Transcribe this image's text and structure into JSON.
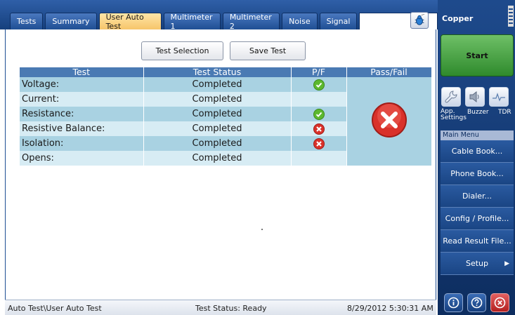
{
  "tabs": [
    {
      "label": "Tests",
      "active": false
    },
    {
      "label": "Summary",
      "active": false
    },
    {
      "label": "User Auto Test",
      "active": true
    },
    {
      "label": "Multimeter 1",
      "active": false
    },
    {
      "label": "Multimeter 2",
      "active": false
    },
    {
      "label": "Noise",
      "active": false
    },
    {
      "label": "Signal",
      "active": false
    }
  ],
  "toolbar": {
    "test_selection": "Test Selection",
    "save_test": "Save Test"
  },
  "table": {
    "headers": {
      "test": "Test",
      "status": "Test Status",
      "pf": "P/F",
      "passfail": "Pass/Fail"
    },
    "rows": [
      {
        "test": "Voltage:",
        "status": "Completed",
        "pf": "pass"
      },
      {
        "test": "Current:",
        "status": "Completed",
        "pf": ""
      },
      {
        "test": "Resistance:",
        "status": "Completed",
        "pf": "pass"
      },
      {
        "test": "Resistive Balance:",
        "status": "Completed",
        "pf": "fail"
      },
      {
        "test": "Isolation:",
        "status": "Completed",
        "pf": "fail"
      },
      {
        "test": "Opens:",
        "status": "Completed",
        "pf": ""
      }
    ],
    "overall": "fail"
  },
  "status_bar": {
    "path": "Auto Test\\User Auto Test",
    "status": "Test Status: Ready",
    "datetime": "8/29/2012 5:30:31 AM"
  },
  "right_panel": {
    "title": "Copper",
    "start": "Start",
    "icons": {
      "app_settings": "App. Settings",
      "buzzer": "Buzzer",
      "tdr": "TDR"
    },
    "menu_header": "Main Menu",
    "menu": [
      "Cable Book...",
      "Phone Book...",
      "Dialer...",
      "Config / Profile...",
      "Read Result File...",
      "Setup"
    ]
  },
  "colors": {
    "header_blue": "#4a7ab3",
    "row_dark": "#a9d2e2",
    "row_light": "#d7ecf4",
    "active_tab": "#f6c56a",
    "start_green": "#3e9a3a"
  }
}
